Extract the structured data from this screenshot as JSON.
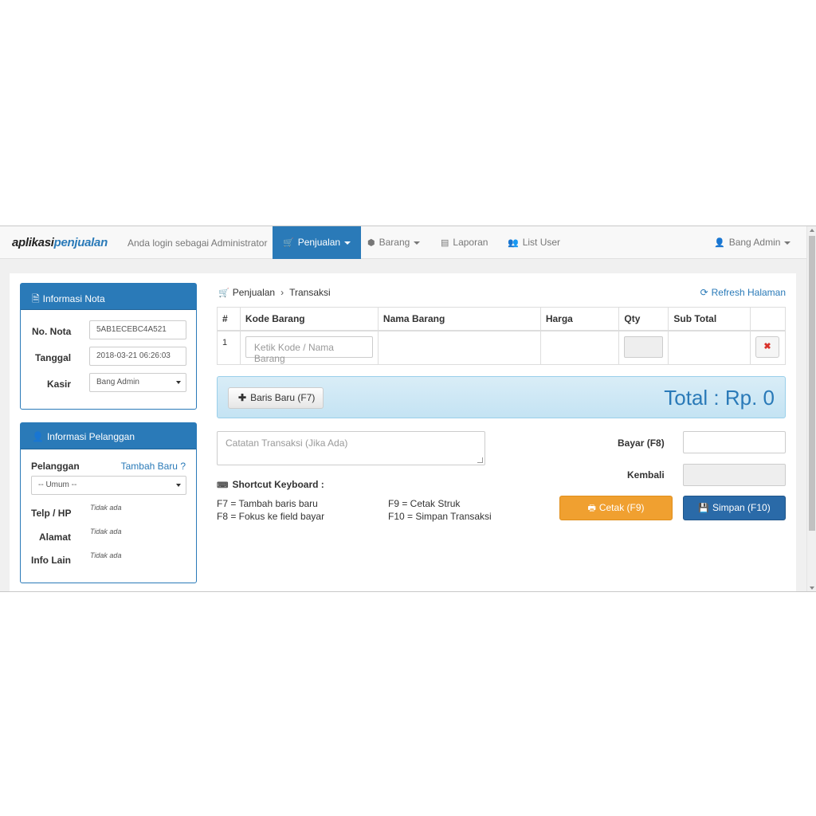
{
  "navbar": {
    "brand_part1": "aplikasi",
    "brand_part2": "penjualan",
    "login_text": "Anda login sebagai Administrator",
    "items": [
      {
        "label": "Penjualan",
        "icon": "cart-icon"
      },
      {
        "label": "Barang",
        "icon": "cube-icon"
      },
      {
        "label": "Laporan",
        "icon": "file-icon"
      },
      {
        "label": "List User",
        "icon": "users-icon"
      }
    ],
    "user_label": "Bang Admin",
    "accent_color": "#2a7ab8"
  },
  "nota": {
    "title": "Informasi Nota",
    "no_nota_label": "No. Nota",
    "no_nota_value": "5AB1ECEBC4A521",
    "tanggal_label": "Tanggal",
    "tanggal_value": "2018-03-21 06:26:03",
    "kasir_label": "Kasir",
    "kasir_value": "Bang Admin"
  },
  "pelanggan": {
    "title": "Informasi Pelanggan",
    "pelanggan_label": "Pelanggan",
    "tambah_baru": "Tambah Baru ?",
    "select_value": "-- Umum --",
    "telp_label": "Telp / HP",
    "telp_value": "Tidak ada",
    "alamat_label": "Alamat",
    "alamat_value": "Tidak ada",
    "info_label": "Info Lain",
    "info_value": "Tidak ada"
  },
  "breadcrumb": {
    "root": "Penjualan",
    "separator": "›",
    "current": "Transaksi"
  },
  "refresh_label": "Refresh Halaman",
  "table": {
    "headers": [
      "#",
      "Kode Barang",
      "Nama Barang",
      "Harga",
      "Qty",
      "Sub Total"
    ],
    "rows": [
      {
        "no": "1",
        "kode_placeholder": "Ketik Kode / Nama Barang",
        "delete_label": "✖"
      }
    ]
  },
  "baris_baru_label": "Baris Baru (F7)",
  "total_text": "Total : Rp. 0",
  "catatan_placeholder": "Catatan Transaksi (Jika Ada)",
  "shortcut": {
    "title": "Shortcut Keyboard :",
    "items": [
      "F7 = Tambah baris baru",
      "F8 = Fokus ke field bayar",
      "F9 = Cetak Struk",
      "F10 = Simpan Transaksi"
    ]
  },
  "bayar_label": "Bayar (F8)",
  "kembali_label": "Kembali",
  "cetak_label": "Cetak (F9)",
  "simpan_label": "Simpan (F10)",
  "colors": {
    "primary": "#2a7ab8",
    "warning": "#f0a030",
    "danger": "#d9322b"
  }
}
